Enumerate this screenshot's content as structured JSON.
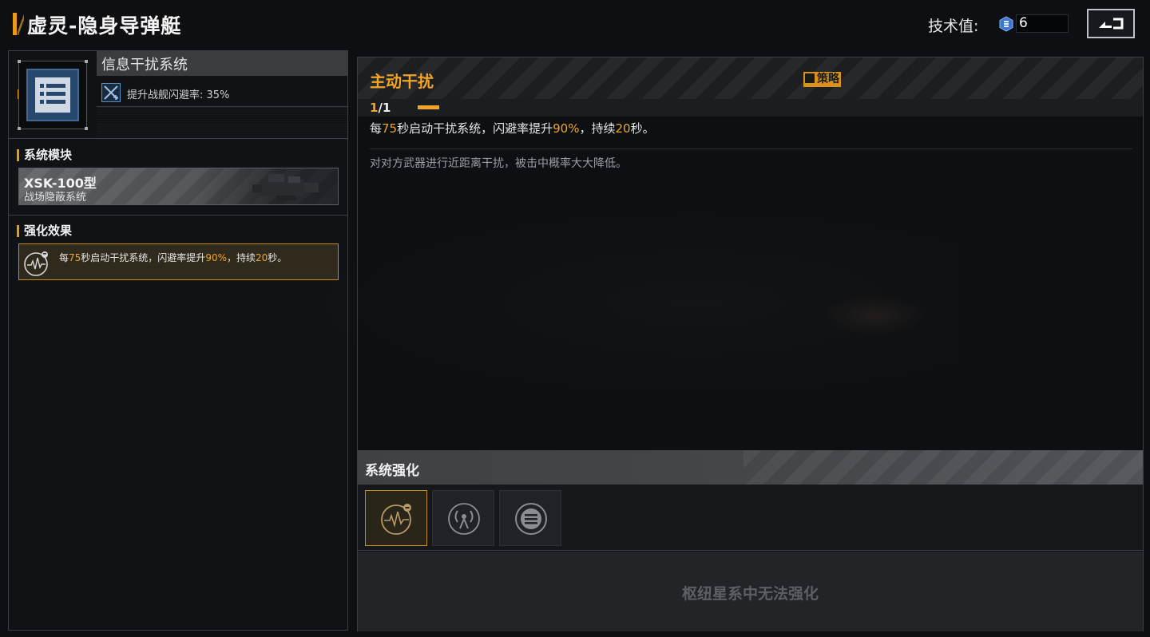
{
  "header": {
    "title": "虚灵-隐身导弹艇",
    "tech_label": "技术值:",
    "tech_value": "6",
    "back_icon": "back-arrow-icon"
  },
  "module": {
    "name": "信息干扰系统",
    "icon": "list-document-icon",
    "stat_icon": "evasion-icon",
    "stat_text": "提升战舰闪避率: 35%"
  },
  "system_module": {
    "heading": "系统模块",
    "model": "XSK-100型",
    "desc": "战场隐蔽系统"
  },
  "enhance_effect": {
    "heading": "强化效果",
    "icon": "heartbeat-signal-icon",
    "parts": [
      "每",
      "75",
      "秒启动干扰系统，闪避率提升",
      "90%",
      "，持续",
      "20",
      "秒。"
    ]
  },
  "skill": {
    "name": "主动干扰",
    "tag": "策略",
    "level_current": "1",
    "level_sep": "/",
    "level_max": "1",
    "level_fraction": 1,
    "desc_parts": [
      "每",
      "75",
      "秒启动干扰系统，闪避率提升",
      "90%",
      "，持续",
      "20",
      "秒。"
    ],
    "flavor": "对对方武器进行近距离干扰，被击中概率大大降低。"
  },
  "system_enhance": {
    "heading": "系统强化",
    "slots": [
      {
        "icon": "heartbeat-signal-icon",
        "active": true
      },
      {
        "icon": "broadcast-tower-icon",
        "active": false
      },
      {
        "icon": "menu-circle-icon",
        "active": false
      }
    ],
    "locked_text": "枢纽星系中无法强化"
  },
  "colors": {
    "accent": "#f0a428",
    "active_border": "#c98a1c"
  }
}
